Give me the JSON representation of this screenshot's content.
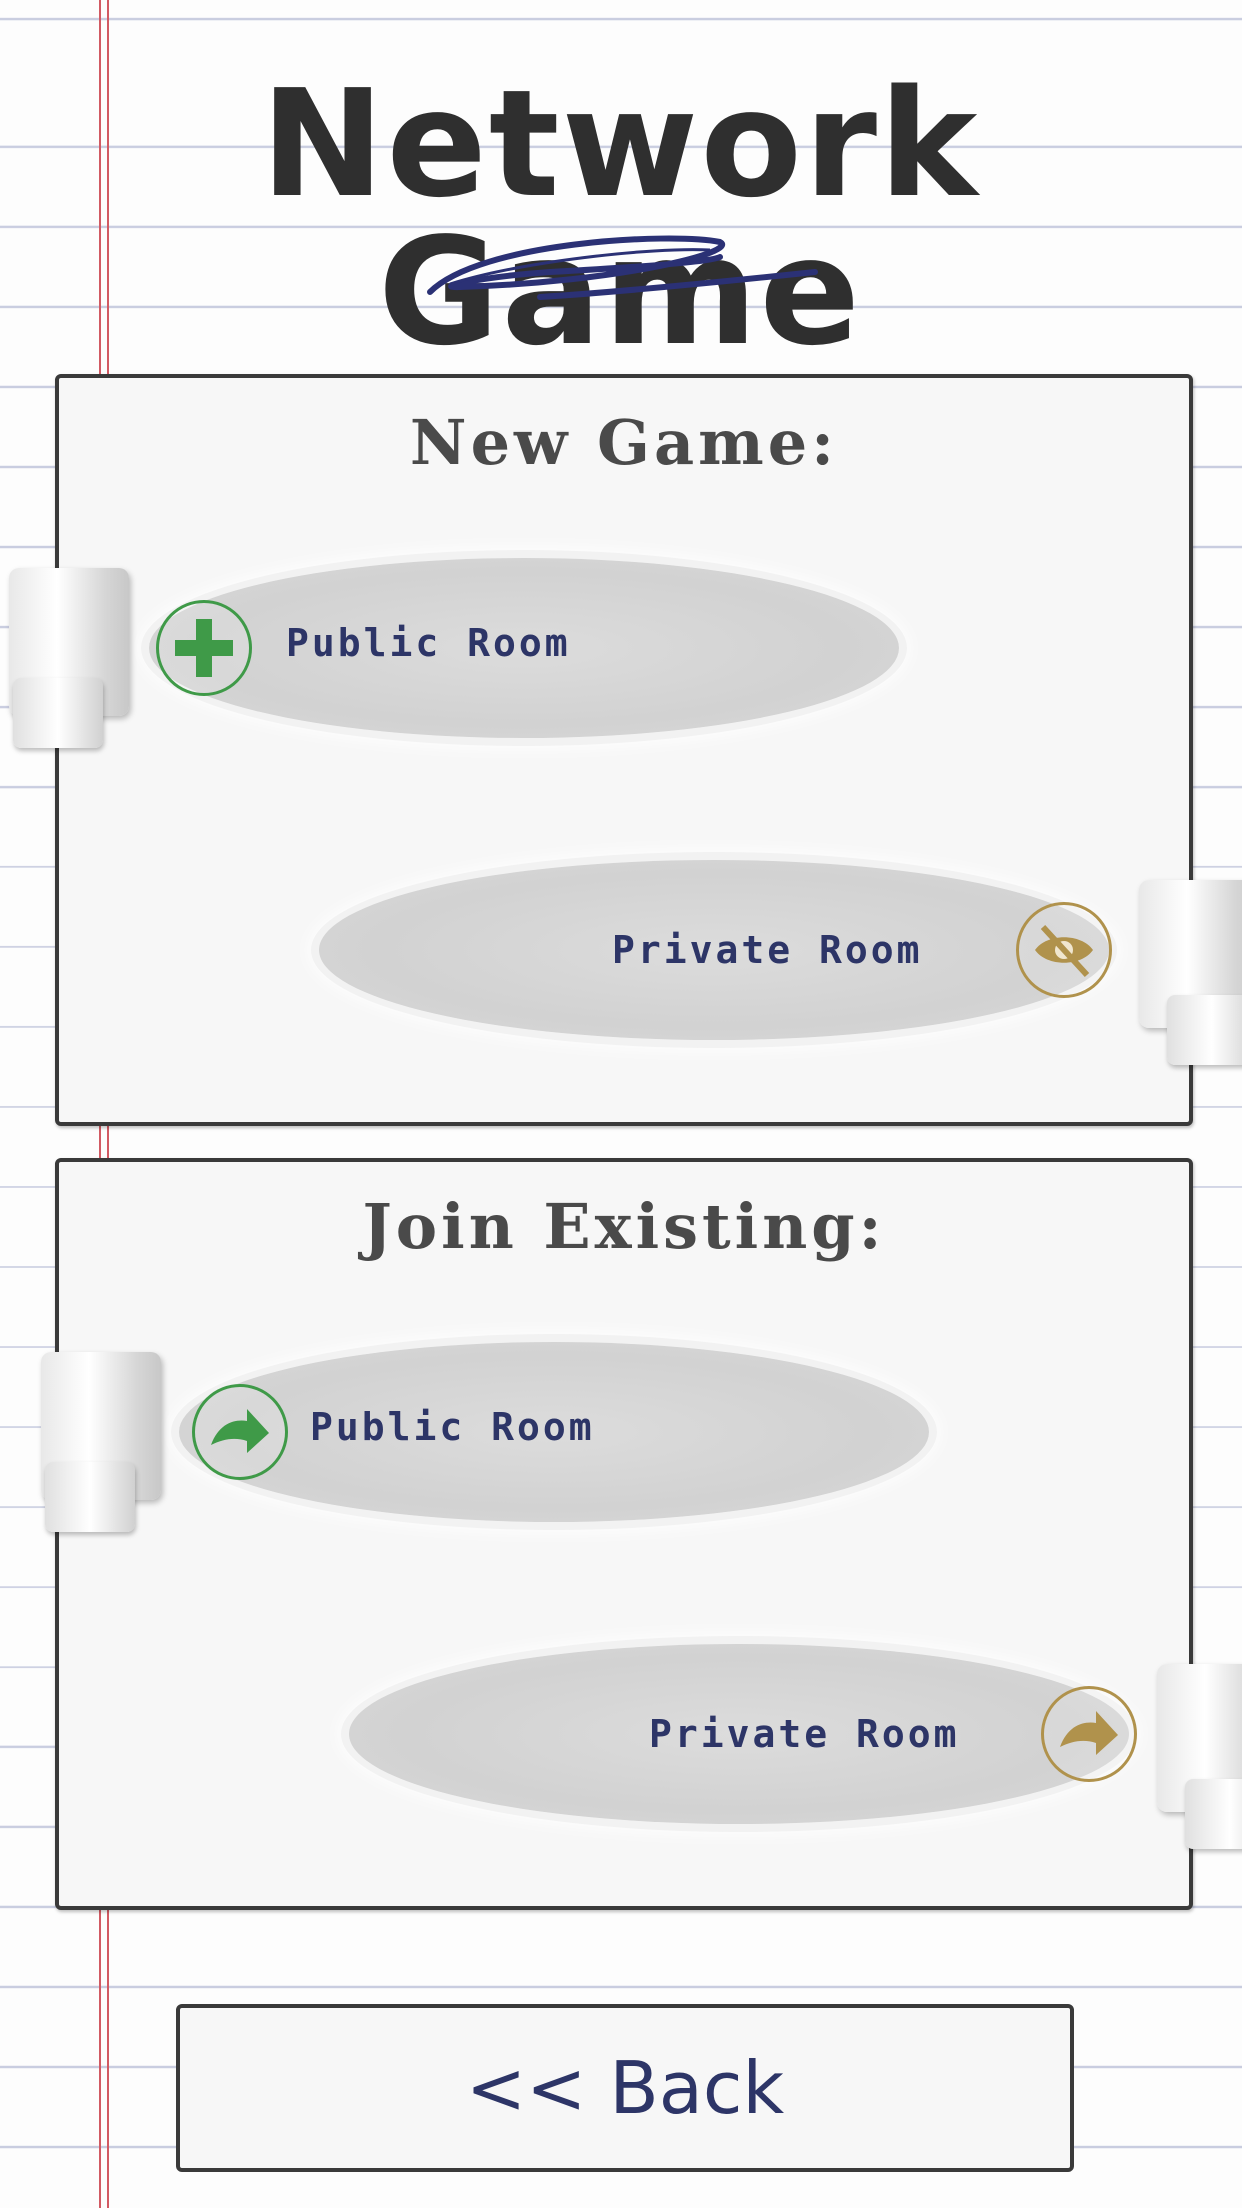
{
  "title": "Network Game",
  "new_game": {
    "heading": "New Game:",
    "public_label": "Public Room",
    "public_icon": "plus-icon",
    "private_label": "Private Room",
    "private_icon": "eye-off-icon"
  },
  "join_existing": {
    "heading": "Join Existing:",
    "public_label": "Public Room",
    "public_icon": "arrow-enter-icon",
    "private_label": "Private Room",
    "private_icon": "arrow-enter-icon"
  },
  "back_label": "<< Back",
  "colors": {
    "public": "#3f9a48",
    "private": "#b0924c",
    "label": "#2d3567",
    "margin": "#d25a63"
  }
}
